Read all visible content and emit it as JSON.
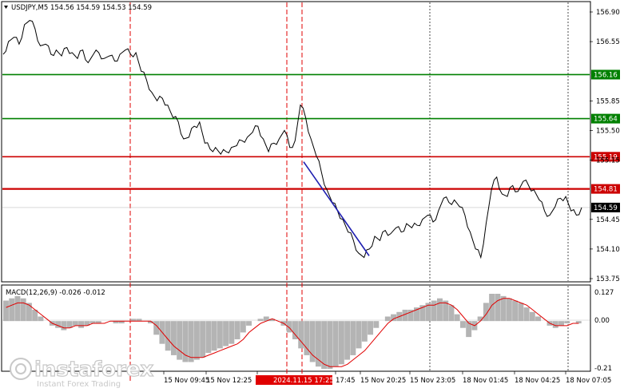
{
  "header": {
    "symbol_info": "USDJPY,M5  154.56 154.59 154.53 154.59"
  },
  "macd": {
    "label": "MACD(12,26,9) -0.026 -0.012",
    "axis_labels": [
      "0.127",
      "0.00",
      "-0.21"
    ]
  },
  "watermark": {
    "brand": "instaforex",
    "tagline": "Instant Forex Trading"
  },
  "colors": {
    "price_line": "#000000",
    "support_green": "#008000",
    "resistance_red": "#cc0000",
    "signal_blue": "#1f1fb0",
    "macd_hist": "#b4b4b4",
    "macd_signal": "#e00000",
    "vline_red": "#e00000"
  },
  "chart_data": [
    {
      "type": "line",
      "title": "USDJPY,M5  154.56 154.59 154.53 154.59",
      "y_ticks": [
        "156.90",
        "156.55",
        "155.85",
        "155.50",
        "155.15",
        "154.45",
        "154.10",
        "153.75"
      ],
      "ylim": [
        153.7,
        157.0
      ],
      "x_tick_labels": [
        "15 Nov 09:45",
        "15 Nov 12:25",
        "2024.11.15 17:25",
        "17:45",
        "15 Nov 20:25",
        "15 Nov 23:05",
        "18 Nov 01:45",
        "18 Nov 04:25",
        "18 Nov 07:05"
      ],
      "horizontal_levels": [
        {
          "value": 156.16,
          "label": "156.16",
          "color": "green"
        },
        {
          "value": 155.64,
          "label": "155.64",
          "color": "green"
        },
        {
          "value": 155.19,
          "label": "155.19",
          "color": "red"
        },
        {
          "value": 154.81,
          "label": "154.81",
          "color": "red"
        },
        {
          "value": 154.59,
          "label": "154.59",
          "color": "current"
        }
      ],
      "price_series": [
        156.4,
        156.55,
        156.6,
        156.52,
        156.75,
        156.8,
        156.7,
        156.5,
        156.52,
        156.4,
        156.45,
        156.38,
        156.48,
        156.42,
        156.35,
        156.45,
        156.3,
        156.4,
        156.42,
        156.35,
        156.38,
        156.32,
        156.4,
        156.45,
        156.4,
        156.42,
        156.2,
        156.1,
        155.95,
        155.85,
        155.88,
        155.8,
        155.65,
        155.6,
        155.4,
        155.42,
        155.55,
        155.6,
        155.35,
        155.28,
        155.3,
        155.22,
        155.25,
        155.3,
        155.32,
        155.38,
        155.42,
        155.48,
        155.55,
        155.4,
        155.25,
        155.35,
        155.4,
        155.5,
        155.3,
        155.38,
        155.8,
        155.65,
        155.4,
        155.2,
        155.0,
        154.8,
        154.65,
        154.55,
        154.45,
        154.3,
        154.2,
        154.05,
        154.0,
        154.1,
        154.25,
        154.2,
        154.32,
        154.28,
        154.35,
        154.3,
        154.4,
        154.35,
        154.38,
        154.45,
        154.5,
        154.42,
        154.55,
        154.7,
        154.65,
        154.68,
        154.6,
        154.5,
        154.3,
        154.1,
        154.0,
        154.4,
        154.8,
        154.95,
        154.75,
        154.72,
        154.85,
        154.78,
        154.9,
        154.85,
        154.8,
        154.68,
        154.55,
        154.5,
        154.6,
        154.7,
        154.72,
        154.55,
        154.5,
        154.59
      ],
      "annotations": [
        {
          "type": "trend_line",
          "from": 155.13,
          "to": 154.02,
          "color": "blue"
        }
      ]
    },
    {
      "type": "bar",
      "title": "MACD(12,26,9) -0.026 -0.012",
      "ylim": [
        -0.21,
        0.127
      ],
      "histogram": [
        0.09,
        0.1,
        0.11,
        0.1,
        0.08,
        0.05,
        0.02,
        0.0,
        -0.02,
        -0.03,
        -0.04,
        -0.03,
        -0.02,
        -0.03,
        -0.02,
        -0.01,
        -0.01,
        0.0,
        0.0,
        -0.01,
        -0.01,
        0.0,
        0.01,
        0.01,
        0.0,
        -0.01,
        -0.06,
        -0.1,
        -0.13,
        -0.15,
        -0.17,
        -0.18,
        -0.18,
        -0.17,
        -0.16,
        -0.14,
        -0.13,
        -0.12,
        -0.11,
        -0.1,
        -0.08,
        -0.05,
        -0.02,
        0.0,
        0.01,
        0.02,
        0.01,
        0.0,
        -0.02,
        -0.05,
        -0.08,
        -0.12,
        -0.15,
        -0.18,
        -0.2,
        -0.21,
        -0.21,
        -0.2,
        -0.19,
        -0.17,
        -0.15,
        -0.12,
        -0.09,
        -0.06,
        -0.03,
        0.0,
        0.02,
        0.03,
        0.04,
        0.05,
        0.05,
        0.06,
        0.07,
        0.08,
        0.09,
        0.1,
        0.09,
        0.07,
        0.03,
        -0.03,
        -0.07,
        -0.04,
        0.02,
        0.08,
        0.12,
        0.12,
        0.11,
        0.1,
        0.09,
        0.08,
        0.06,
        0.04,
        0.02,
        0.0,
        -0.02,
        -0.03,
        -0.02,
        -0.01,
        0.0,
        -0.01
      ],
      "signal": [
        0.06,
        0.07,
        0.08,
        0.08,
        0.07,
        0.05,
        0.03,
        0.01,
        -0.01,
        -0.02,
        -0.03,
        -0.03,
        -0.02,
        -0.02,
        -0.02,
        -0.01,
        -0.01,
        -0.01,
        0.0,
        0.0,
        0.0,
        0.0,
        0.0,
        0.0,
        0.0,
        0.0,
        -0.02,
        -0.05,
        -0.08,
        -0.11,
        -0.13,
        -0.15,
        -0.16,
        -0.16,
        -0.16,
        -0.15,
        -0.14,
        -0.13,
        -0.12,
        -0.11,
        -0.1,
        -0.08,
        -0.05,
        -0.03,
        -0.01,
        0.0,
        0.01,
        0.0,
        -0.01,
        -0.03,
        -0.06,
        -0.09,
        -0.12,
        -0.15,
        -0.17,
        -0.19,
        -0.2,
        -0.2,
        -0.2,
        -0.19,
        -0.17,
        -0.15,
        -0.13,
        -0.1,
        -0.07,
        -0.04,
        -0.01,
        0.01,
        0.02,
        0.03,
        0.04,
        0.05,
        0.06,
        0.07,
        0.07,
        0.08,
        0.08,
        0.07,
        0.05,
        0.02,
        -0.01,
        -0.02,
        0.0,
        0.03,
        0.07,
        0.09,
        0.1,
        0.1,
        0.09,
        0.08,
        0.07,
        0.05,
        0.03,
        0.01,
        -0.01,
        -0.02,
        -0.02,
        -0.02,
        -0.01,
        -0.01
      ]
    }
  ]
}
